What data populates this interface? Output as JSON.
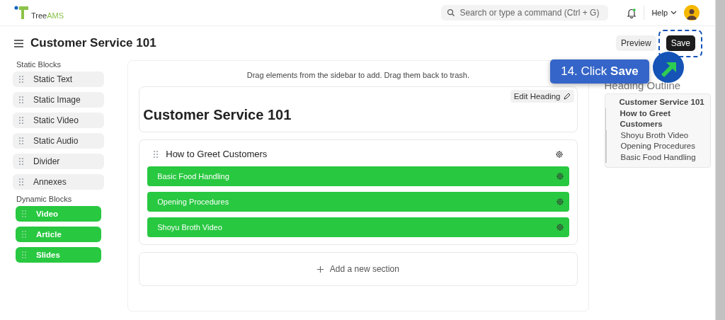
{
  "header": {
    "logo_text": "Tree",
    "logo_accent": "AMS",
    "search": {
      "placeholder": "Search or type a command (Ctrl + G)"
    },
    "notification_dot": true,
    "help": "Help"
  },
  "page": {
    "title": "Customer Service 101",
    "buttons": [
      {
        "label": "Preview",
        "kind": "secondary"
      },
      {
        "label": "Save",
        "kind": "primary"
      }
    ]
  },
  "sidebar": {
    "groups": [
      {
        "title": "Static Blocks",
        "kind": "static",
        "items": [
          "Static Text",
          "Static Image",
          "Static Video",
          "Static Audio",
          "Divider",
          "Annexes"
        ]
      },
      {
        "title": "Dynamic Blocks",
        "kind": "dynamic",
        "items": [
          "Video",
          "Article",
          "Slides"
        ]
      }
    ]
  },
  "editor": {
    "hint": "Drag elements from the sidebar to add. Drag them back to trash.",
    "edit_heading": "Edit Heading",
    "heading": "Customer Service 101",
    "section": {
      "title": "How to Greet Customers",
      "blocks": [
        "Basic Food Handling",
        "Opening Procedures",
        "Shoyu Broth Video"
      ]
    },
    "add_section": "Add a new section"
  },
  "outline": {
    "title": "Heading Outline",
    "items": [
      {
        "label": "Customer Service 101",
        "children": [
          {
            "label": "How to Greet Customers",
            "children": [
              {
                "label": "Shoyu Broth Video"
              },
              {
                "label": "Opening Procedures"
              },
              {
                "label": "Basic Food Handling"
              }
            ]
          }
        ]
      }
    ]
  },
  "callout": {
    "text": "14. Click **Save**"
  }
}
